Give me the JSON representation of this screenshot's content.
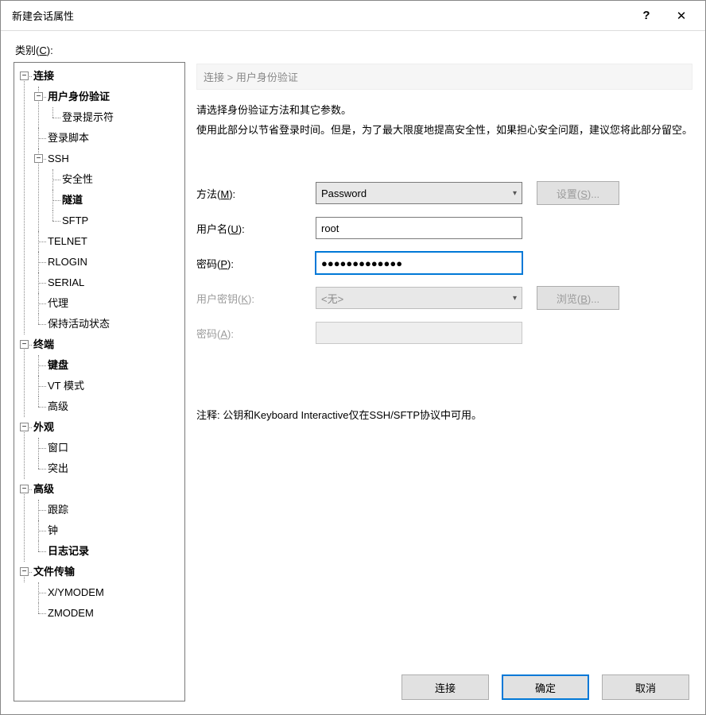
{
  "title": "新建会话属性",
  "help_symbol": "?",
  "close_symbol": "✕",
  "category_label_prefix": "类别(",
  "category_label_u": "C",
  "category_label_suffix": "):",
  "tree": {
    "connection": "连接",
    "auth": "用户身份验证",
    "login_prompt": "登录提示符",
    "login_script": "登录脚本",
    "ssh": "SSH",
    "security": "安全性",
    "tunnel": "隧道",
    "sftp": "SFTP",
    "telnet": "TELNET",
    "rlogin": "RLOGIN",
    "serial": "SERIAL",
    "proxy": "代理",
    "keepalive": "保持活动状态",
    "terminal": "终端",
    "keyboard": "键盘",
    "vt_mode": "VT 模式",
    "advanced_term": "高级",
    "appearance": "外观",
    "window": "窗口",
    "highlight": "突出",
    "advanced": "高级",
    "trace": "跟踪",
    "clock": "钟",
    "logging": "日志记录",
    "file_transfer": "文件传输",
    "xymodem": "X/YMODEM",
    "zmodem": "ZMODEM"
  },
  "breadcrumb": "连接 > 用户身份验证",
  "desc_line1": "请选择身份验证方法和其它参数。",
  "desc_line2": "使用此部分以节省登录时间。但是，为了最大限度地提高安全性，如果担心安全问题，建议您将此部分留空。",
  "labels": {
    "method_pre": "方法(",
    "method_u": "M",
    "method_post": "):",
    "username_pre": "用户名(",
    "username_u": "U",
    "username_post": "):",
    "password_pre": "密码(",
    "password_u": "P",
    "password_post": "):",
    "userkey_pre": "用户密钥(",
    "userkey_u": "K",
    "userkey_post": "):",
    "passphrase_pre": "密码(",
    "passphrase_u": "A",
    "passphrase_post": ":"
  },
  "values": {
    "method": "Password",
    "username": "root",
    "password": "●●●●●●●●●●●●●",
    "userkey": "<无>"
  },
  "buttons": {
    "settings_pre": "设置(",
    "settings_u": "S",
    "settings_post": ")...",
    "browse_pre": "浏览(",
    "browse_u": "B",
    "browse_post": ")..."
  },
  "note": "注释: 公钥和Keyboard Interactive仅在SSH/SFTP协议中可用。",
  "footer": {
    "connect": "连接",
    "ok": "确定",
    "cancel": "取消"
  }
}
